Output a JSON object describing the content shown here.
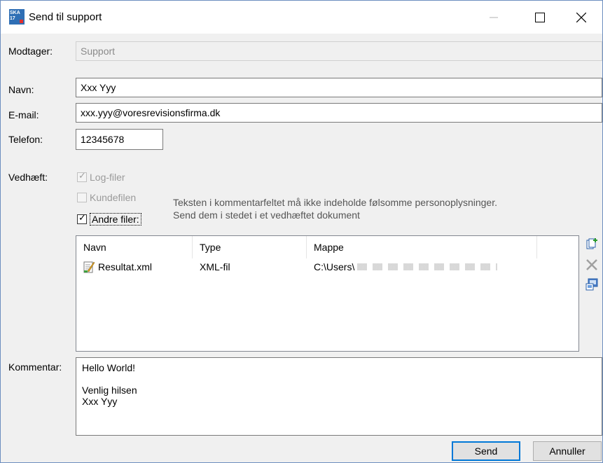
{
  "window": {
    "title": "Send til support",
    "icon_text": "SKA 17"
  },
  "form": {
    "recipient_label": "Modtager:",
    "recipient_value": "Support",
    "name_label": "Navn:",
    "name_value": "Xxx Yyy",
    "email_label": "E-mail:",
    "email_value": "xxx.yyy@voresrevisionsfirma.dk",
    "phone_label": "Telefon:",
    "phone_value": "12345678",
    "attach_label": "Vedhæft:",
    "attachments": {
      "log_files": "Log-filer",
      "customer_file": "Kundefilen",
      "other_files": "Andre filer:"
    },
    "note_line1": "Teksten i kommentarfeltet må ikke indeholde følsomme personoplysninger.",
    "note_line2": "Send dem i stedet i et vedhæftet dokument",
    "comment_label": "Kommentar:",
    "comment_lines": [
      "Hello World!",
      "",
      "Venlig hilsen",
      "Xxx Yyy"
    ]
  },
  "files_table": {
    "columns": [
      "Navn",
      "Type",
      "Mappe"
    ],
    "rows": [
      {
        "name": "Resultat.xml",
        "type": "XML-fil",
        "folder": "C:\\Users\\"
      }
    ]
  },
  "side_icons": [
    "add-file-icon",
    "delete-icon",
    "scan-icon"
  ],
  "buttons": {
    "send": "Send",
    "cancel": "Annuller"
  },
  "colors": {
    "accent": "#0078d7",
    "dialog_bg": "#f0f0f0"
  }
}
